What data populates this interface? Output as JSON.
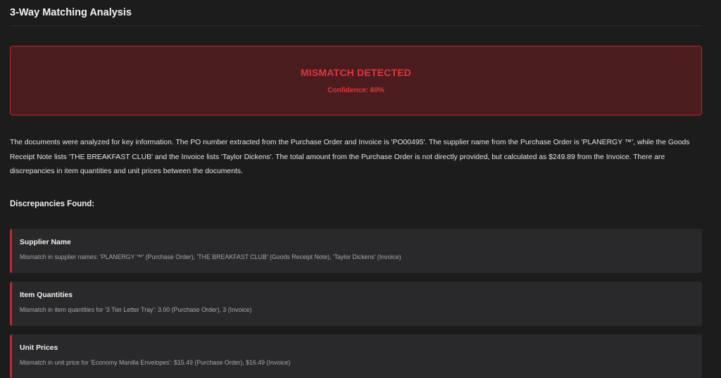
{
  "header": {
    "title": "3-Way Matching Analysis"
  },
  "status": {
    "label": "MISMATCH DETECTED",
    "confidence_text": "Confidence: 60%",
    "color": "#e0373a"
  },
  "summary": {
    "text": "The documents were analyzed for key information. The PO number extracted from the Purchase Order and Invoice is 'PO00495'. The supplier name from the Purchase Order is 'PLANERGY ™', while the Goods Receipt Note lists 'THE BREAKFAST CLUB' and the Invoice lists 'Taylor Dickens'. The total amount from the Purchase Order is not directly provided, but calculated as $249.89 from the Invoice. There are discrepancies in item quantities and unit prices between the documents."
  },
  "discrepancies": {
    "heading": "Discrepancies Found:",
    "items": [
      {
        "title": "Supplier Name",
        "detail": "Mismatch in supplier names: 'PLANERGY ™' (Purchase Order), 'THE BREAKFAST CLUB' (Goods Receipt Note), 'Taylor Dickens' (Invoice)"
      },
      {
        "title": "Item Quantities",
        "detail": "Mismatch in item quantities for '3 Tier Letter Tray': 3.00 (Purchase Order), 3 (Invoice)"
      },
      {
        "title": "Unit Prices",
        "detail": "Mismatch in unit price for 'Economy Manilla Envelopes': $15.49 (Purchase Order), $16.49 (Invoice)"
      }
    ]
  }
}
